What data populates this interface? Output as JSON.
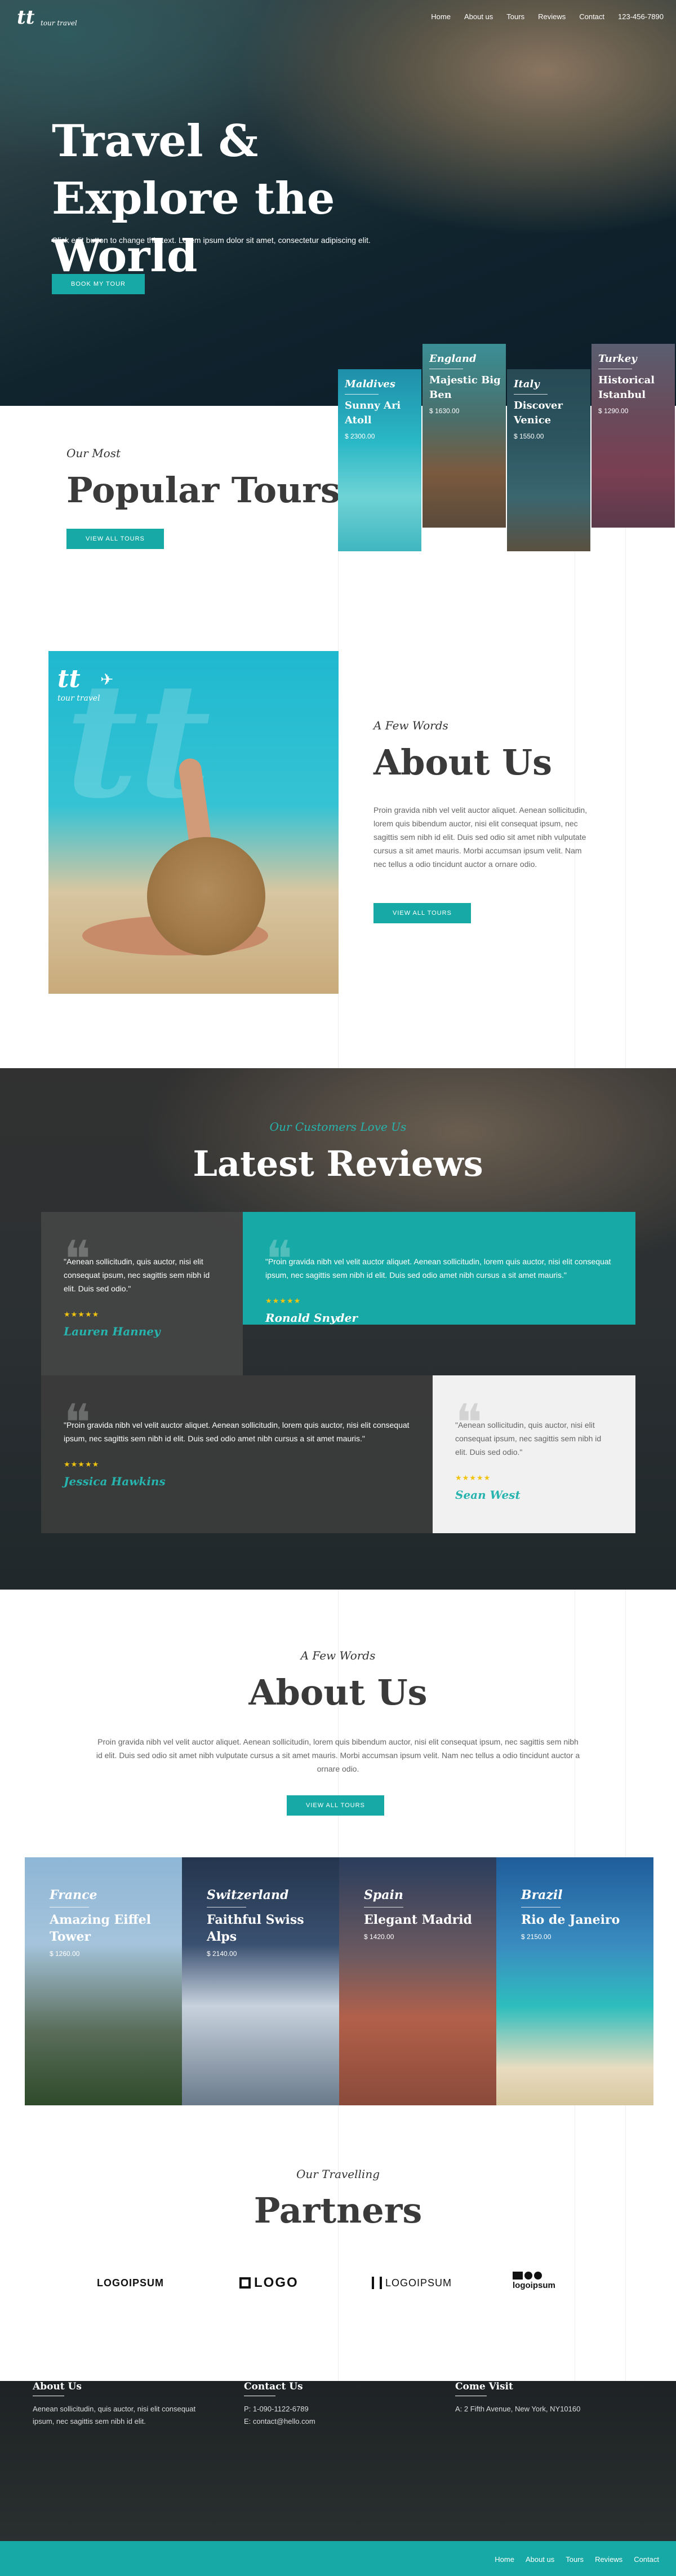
{
  "brand": {
    "mark": "tt",
    "tagline": "tour travel"
  },
  "nav": {
    "items": [
      "Home",
      "About us",
      "Tours",
      "Reviews",
      "Contact"
    ],
    "phone": "123-456-7890"
  },
  "hero": {
    "title": "Travel & Explore the World",
    "subtitle": "Click edit button to change this text. Lorem ipsum dolor sit amet, consectetur adipiscing elit.",
    "button": "BOOK MY TOUR"
  },
  "popular": {
    "subtitle": "Our Most",
    "title": "Popular Tours",
    "button": "VIEW ALL TOURS",
    "tours": [
      {
        "country": "Maldives",
        "name": "Sunny Ari Atoll",
        "price": "$ 2300.00"
      },
      {
        "country": "England",
        "name": "Majestic Big Ben",
        "price": "$ 1630.00"
      },
      {
        "country": "Italy",
        "name": "Discover Venice",
        "price": "$ 1550.00"
      },
      {
        "country": "Turkey",
        "name": "Historical Istanbul",
        "price": "$ 1290.00"
      }
    ]
  },
  "about1": {
    "subtitle": "A Few Words",
    "title": "About Us",
    "text": "Proin gravida nibh vel velit auctor aliquet. Aenean sollicitudin, lorem quis bibendum auctor, nisi elit consequat ipsum, nec sagittis sem nibh id elit. Duis sed odio sit amet nibh vulputate cursus a sit amet mauris. Morbi accumsan ipsum velit. Nam nec tellus a odio tincidunt auctor a ornare odio.",
    "button": "VIEW ALL TOURS",
    "image_logo": "tt",
    "image_tagline": "tour travel"
  },
  "reviews": {
    "subtitle": "Our Customers Love Us",
    "title": "Latest Reviews",
    "items": [
      {
        "text": "\"Aenean sollicitudin, quis auctor, nisi elit consequat ipsum, nec sagittis sem nibh id elit. Duis sed odio.\"",
        "stars": "★★★★★",
        "author": "Lauren Hanney"
      },
      {
        "text": "\"Proin gravida nibh vel velit auctor aliquet. Aenean sollicitudin, lorem quis auctor, nisi elit consequat ipsum, nec sagittis sem nibh id elit. Duis sed odio amet nibh cursus a sit amet mauris.\"",
        "stars": "★★★★★",
        "author": "Ronald Snyder"
      },
      {
        "text": "\"Proin gravida nibh vel velit auctor aliquet. Aenean sollicitudin, lorem quis auctor, nisi elit consequat ipsum, nec sagittis sem nibh id elit. Duis sed odio amet nibh cursus a sit amet mauris.\"",
        "stars": "★★★★★",
        "author": "Jessica Hawkins"
      },
      {
        "text": "\"Aenean sollicitudin, quis auctor, nisi elit consequat ipsum, nec sagittis sem nibh id elit. Duis sed odio.\"",
        "stars": "★★★★★",
        "author": "Sean West"
      }
    ]
  },
  "about2": {
    "subtitle": "A Few Words",
    "title": "About Us",
    "text": "Proin gravida nibh vel velit auctor aliquet. Aenean sollicitudin, lorem quis bibendum auctor, nisi elit consequat ipsum, nec sagittis sem nibh id elit. Duis sed odio sit amet nibh vulputate cursus a sit amet mauris. Morbi accumsan ipsum velit. Nam nec tellus a odio tincidunt auctor a ornare odio.",
    "button": "VIEW ALL TOURS",
    "destinations": [
      {
        "country": "France",
        "name": "Amazing Eiffel Tower",
        "price": "$ 1260.00"
      },
      {
        "country": "Switzerland",
        "name": "Faithful Swiss Alps",
        "price": "$ 2140.00"
      },
      {
        "country": "Spain",
        "name": "Elegant Madrid",
        "price": "$ 1420.00"
      },
      {
        "country": "Brazil",
        "name": "Rio de Janeiro",
        "price": "$ 2150.00"
      }
    ]
  },
  "partners": {
    "subtitle": "Our Travelling",
    "title": "Partners",
    "logos": [
      "LOGOIPSUM",
      "LOGO",
      "LOGOIPSUM",
      "logoipsum"
    ]
  },
  "footer": {
    "about": {
      "title": "About Us",
      "text": "Aenean sollicitudin, quis auctor, nisi elit consequat ipsum, nec sagittis sem nibh id elit."
    },
    "contact": {
      "title": "Contact Us",
      "phone": "P: 1-090-1122-6789",
      "email": "E: contact@hello.com"
    },
    "visit": {
      "title": "Come Visit",
      "address": "A: 2 Fifth Avenue, New York, NY10160"
    },
    "menu": [
      "Home",
      "About us",
      "Tours",
      "Reviews",
      "Contact"
    ]
  },
  "colors": {
    "accent": "#17a9a5",
    "dark": "#3a3a3a"
  }
}
